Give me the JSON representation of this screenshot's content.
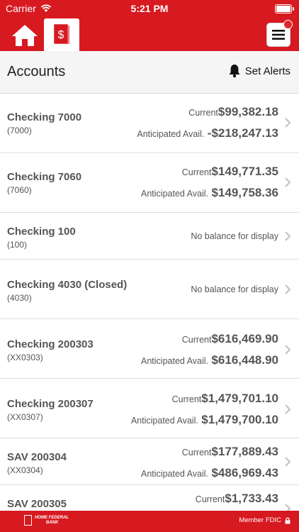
{
  "status_bar": {
    "carrier": "Carrier",
    "time": "5:21 PM"
  },
  "nav": {
    "home_icon": "house-icon",
    "accounts_icon": "dollar-document-icon",
    "menu_icon": "hamburger-icon"
  },
  "header": {
    "title": "Accounts",
    "alerts_label": "Set Alerts"
  },
  "accounts": [
    {
      "name": "Checking 7000",
      "number": "(7000)",
      "current_label": "Current",
      "current": "$99,382.18",
      "anticipated_label": "Anticipated Avail.",
      "anticipated": "-$218,247.13"
    },
    {
      "name": "Checking 7060",
      "number": "(7060)",
      "current_label": "Current",
      "current": "$149,771.35",
      "anticipated_label": "Anticipated Avail.",
      "anticipated": "$149,758.36"
    },
    {
      "name": "Checking 100",
      "number": "(100)",
      "no_balance": "No balance for display"
    },
    {
      "name": "Checking 4030 (Closed)",
      "number": "(4030)",
      "no_balance": "No balance for display"
    },
    {
      "name": "Checking 200303",
      "number": "(XX0303)",
      "current_label": "Current",
      "current": "$616,469.90",
      "anticipated_label": "Anticipated Avail.",
      "anticipated": "$616,448.90"
    },
    {
      "name": "Checking 200307",
      "number": "(XX0307)",
      "current_label": "Current",
      "current": "$1,479,701.10",
      "anticipated_label": "Anticipated Avail.",
      "anticipated": "$1,479,700.10"
    },
    {
      "name": "SAV 200304",
      "number": "(XX0304)",
      "current_label": "Current",
      "current": "$177,889.43",
      "anticipated_label": "Anticipated Avail.",
      "anticipated": "$486,969.43"
    },
    {
      "name": "SAV 200305",
      "current_label": "Current",
      "current": "$1,733.43"
    }
  ],
  "footer": {
    "logo_line1": "HOME FEDERAL",
    "logo_line2": "BANK",
    "fdic": "Member FDIC"
  },
  "colors": {
    "brand": "#d71920"
  }
}
